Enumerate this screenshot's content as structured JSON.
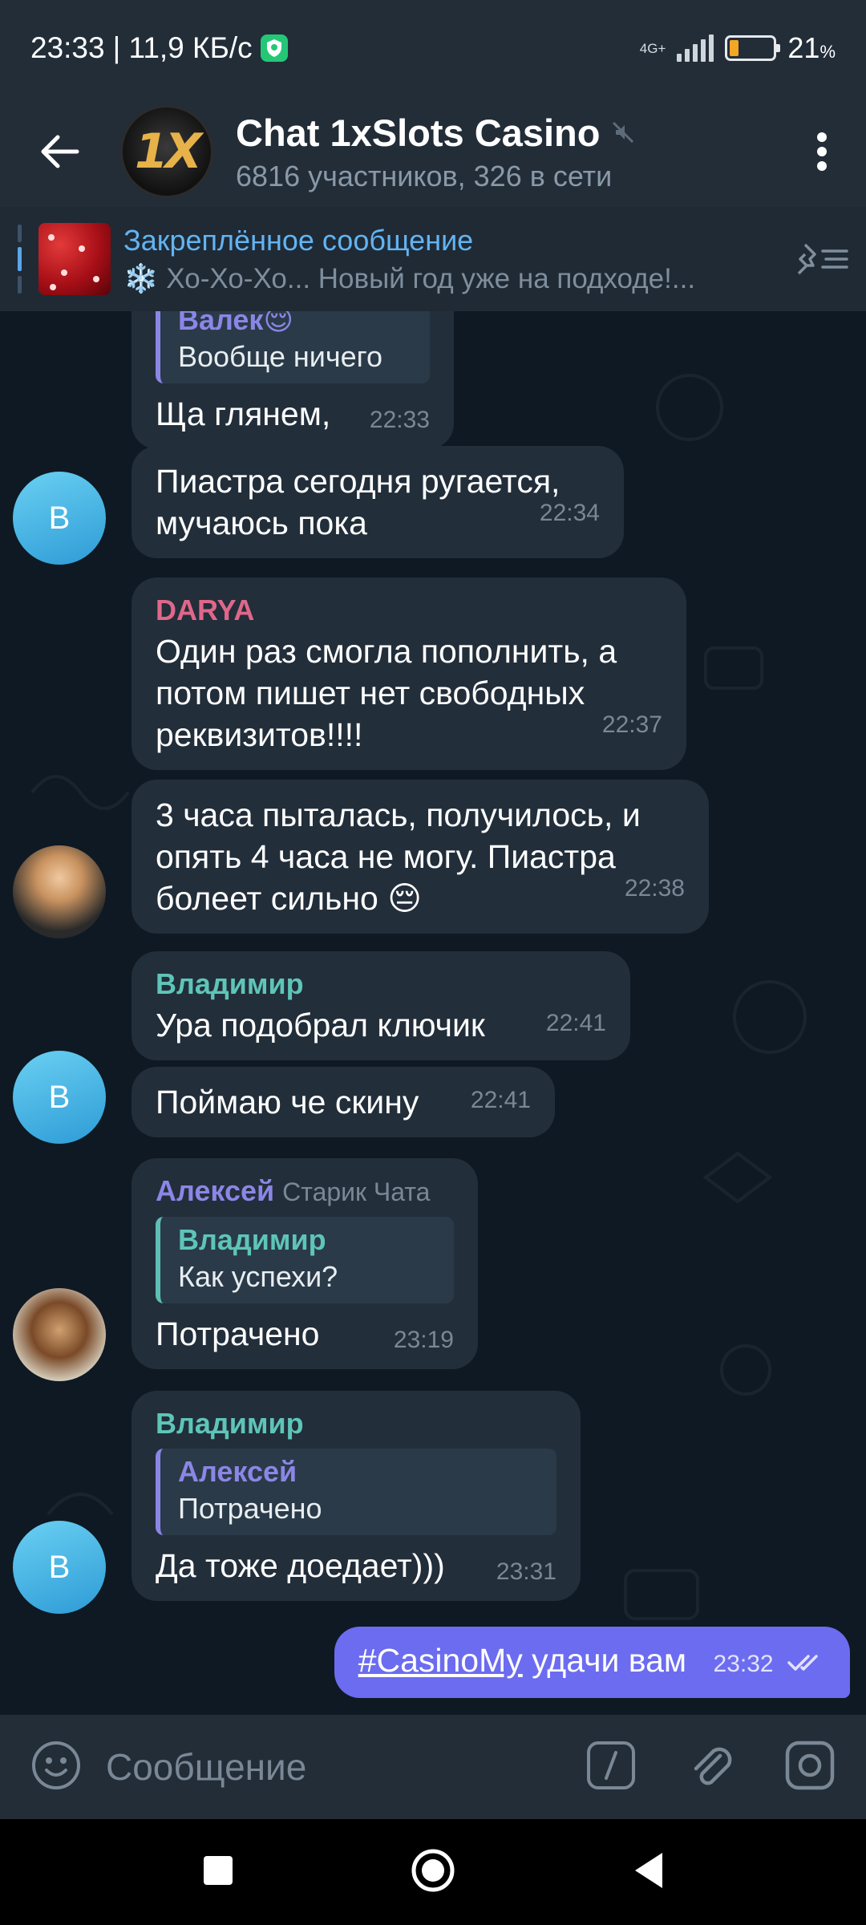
{
  "status_bar": {
    "time": "23:33",
    "speed": "| 11,9 КБ/с",
    "network": "4G+",
    "battery_level": 0.21,
    "battery_value": "21",
    "battery_unit": "%"
  },
  "header": {
    "avatar_text": "1X",
    "title": "Chat 1xSlots Casino",
    "subtitle": "6816 участников, 326 в сети"
  },
  "pinned": {
    "title": "Закреплённое сообщение",
    "preview": "❄️ Хо-Хо-Хо... Новый год уже на подходе!..."
  },
  "messages": [
    {
      "quote_name": "Валек😌",
      "quote_text": "Вообще ничего",
      "text": "Ща глянем,",
      "time": "22:33"
    },
    {
      "avatar": "B",
      "text": "Пиастра сегодня ругается, мучаюсь пока",
      "time": "22:34"
    },
    {
      "sender": "DARYA",
      "text": "Один раз смогла пополнить, а потом пишет нет свободных реквизитов!!!!",
      "time": "22:37"
    },
    {
      "text": "3 часа пыталась, получилось, и опять 4 часа не могу. Пиастра болеет сильно 😔",
      "time": "22:38"
    },
    {
      "sender": "Владимир",
      "text": "Ура подобрал ключик",
      "time": "22:41"
    },
    {
      "avatar": "B",
      "text": "Поймаю че скину",
      "time": "22:41"
    },
    {
      "sender": "Алексей",
      "sender_tag": "Старик Чата",
      "quote_name": "Владимир",
      "quote_text": "Как успехи?",
      "text": "Потрачено",
      "time": "23:19"
    },
    {
      "avatar": "B",
      "sender": "Владимир",
      "quote_name": "Алексей",
      "quote_text": "Потрачено",
      "text": "Да тоже доедает)))",
      "time": "23:31"
    }
  ],
  "outgoing": {
    "hashtag": "#CasinoMy",
    "text": " удачи вам",
    "time": "23:32"
  },
  "composer": {
    "placeholder": "Сообщение"
  },
  "colors": {
    "accent": "#63b4f2",
    "outgoing_bubble": "#6c6cf0",
    "name_darya": "#e0678a",
    "name_vladimir": "#5ec5b8",
    "name_aleksey": "#8b86e6"
  }
}
